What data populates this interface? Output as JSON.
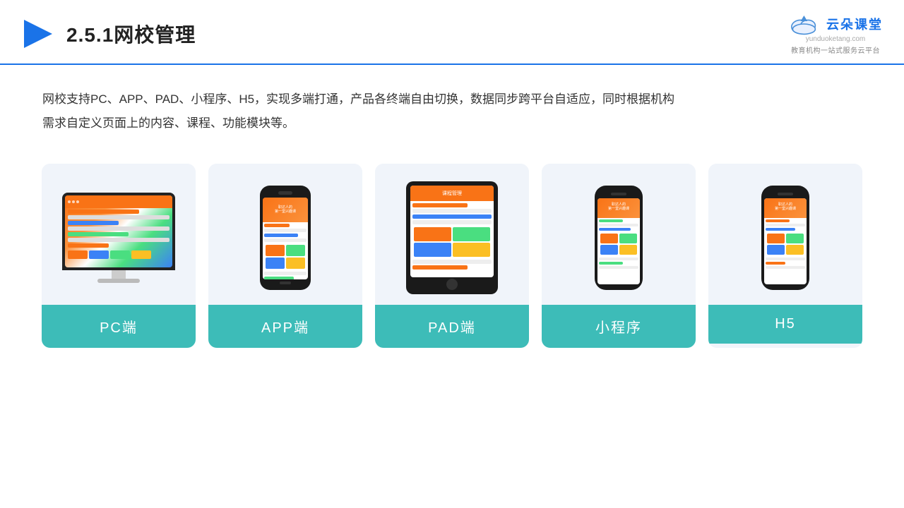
{
  "header": {
    "title": "2.5.1网校管理",
    "logo_cn": "云朵课堂",
    "logo_url": "yunduoketang.com",
    "logo_sub": "教育机构一站式服务云平台"
  },
  "description": {
    "text1": "网校支持PC、APP、PAD、小程序、H5，实现多端打通，产品各终端自由切换，数据同步跨平台自适应，同时根据机构",
    "text2": "需求自定义页面上的内容、课程、功能模块等。"
  },
  "cards": [
    {
      "id": "pc",
      "label": "PC端"
    },
    {
      "id": "app",
      "label": "APP端"
    },
    {
      "id": "pad",
      "label": "PAD端"
    },
    {
      "id": "miniprogram",
      "label": "小程序"
    },
    {
      "id": "h5",
      "label": "H5"
    }
  ],
  "accent_color": "#3dbcb8"
}
